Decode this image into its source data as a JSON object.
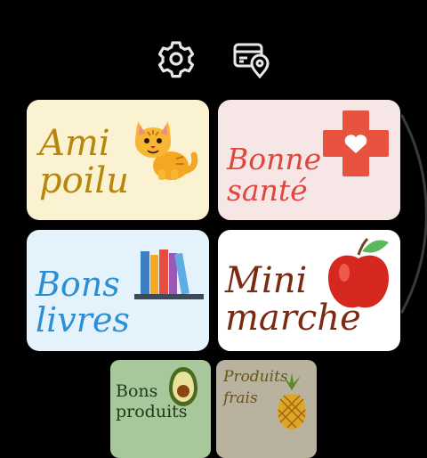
{
  "toolbar": {
    "settings_icon": "gear-icon",
    "store_locator_icon": "store-card-location-icon"
  },
  "tiles": [
    {
      "id": "ami-poilu",
      "line1": "Ami",
      "line2": "poilu",
      "bg": "#fbf2d2",
      "text_color": "#b8860b",
      "icon": "cat-icon"
    },
    {
      "id": "bonne-sante",
      "line1": "Bonne",
      "line2": "santé",
      "bg": "#f7e6e6",
      "text_color": "#e0463c",
      "icon": "medical-cross-heart-icon"
    },
    {
      "id": "bons-livres",
      "line1": "Bons",
      "line2": "livres",
      "bg": "#e3f2fb",
      "text_color": "#2b8fd6",
      "icon": "books-icon"
    },
    {
      "id": "mini-marche",
      "line1": "Mini",
      "line2": "marché",
      "bg": "#ffffff",
      "text_color": "#7a2a10",
      "icon": "apple-icon"
    },
    {
      "id": "bons-produits",
      "line1": "Bons",
      "line2": "produits",
      "bg": "#a8c79a",
      "text_color": "#1e3a1e",
      "icon": "avocado-icon"
    },
    {
      "id": "produits-frais",
      "line1": "Produits",
      "line2": "frais",
      "bg": "#b8b29e",
      "text_color": "#6b5310",
      "icon": "pineapple-icon"
    }
  ]
}
